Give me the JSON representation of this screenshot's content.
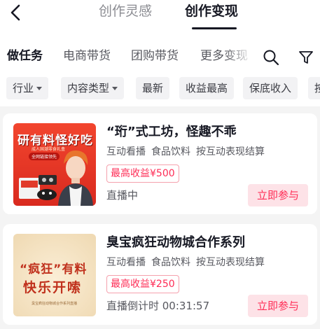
{
  "colors": {
    "accent": "#fe2c55",
    "accent_bg": "#fde2e7",
    "text_primary": "#161823",
    "text_secondary": "#57585f"
  },
  "header": {
    "back_icon": "chevron-left-icon",
    "tabs": [
      {
        "label": "创作灵感",
        "active": false
      },
      {
        "label": "创作变现",
        "active": true
      }
    ]
  },
  "sub_nav": {
    "tabs": [
      {
        "label": "做任务",
        "active": true
      },
      {
        "label": "电商带货",
        "active": false
      },
      {
        "label": "团购带货",
        "active": false
      },
      {
        "label": "更多变现",
        "active": false
      }
    ],
    "search_icon": "search-icon",
    "filter_icon": "filter-icon"
  },
  "filters": {
    "chips": [
      {
        "label": "行业",
        "has_caret": true
      },
      {
        "label": "内容类型",
        "has_caret": true
      },
      {
        "label": "最新",
        "has_caret": false
      },
      {
        "label": "收益最高",
        "has_caret": false
      },
      {
        "label": "保底收入",
        "has_caret": false
      },
      {
        "label": "按",
        "has_caret": false
      }
    ]
  },
  "tasks": [
    {
      "title": "“珩”式工坊，怪趣不乖",
      "tags": [
        "互动看播",
        "食品饮料",
        "按互动表现结算"
      ],
      "reward": "最高收益¥500",
      "status": "直播中",
      "action": "立即参与",
      "thumbnail": {
        "title": "研有料怪好吃",
        "subtitle": "成人国潮零食礼盒",
        "pill": "全网链接领先"
      }
    },
    {
      "title": "臭宝疯狂动物城合作系列",
      "tags": [
        "互动看播",
        "食品饮料",
        "按互动表现结算"
      ],
      "reward": "最高收益¥250",
      "status": "直播倒计时 00:31:57",
      "action": "立即参与",
      "thumbnail": {
        "line1": "“疯狂”有料",
        "line2": "快乐开嗦",
        "caption": "臭宝疯狂动物城合作系列直播"
      }
    }
  ]
}
